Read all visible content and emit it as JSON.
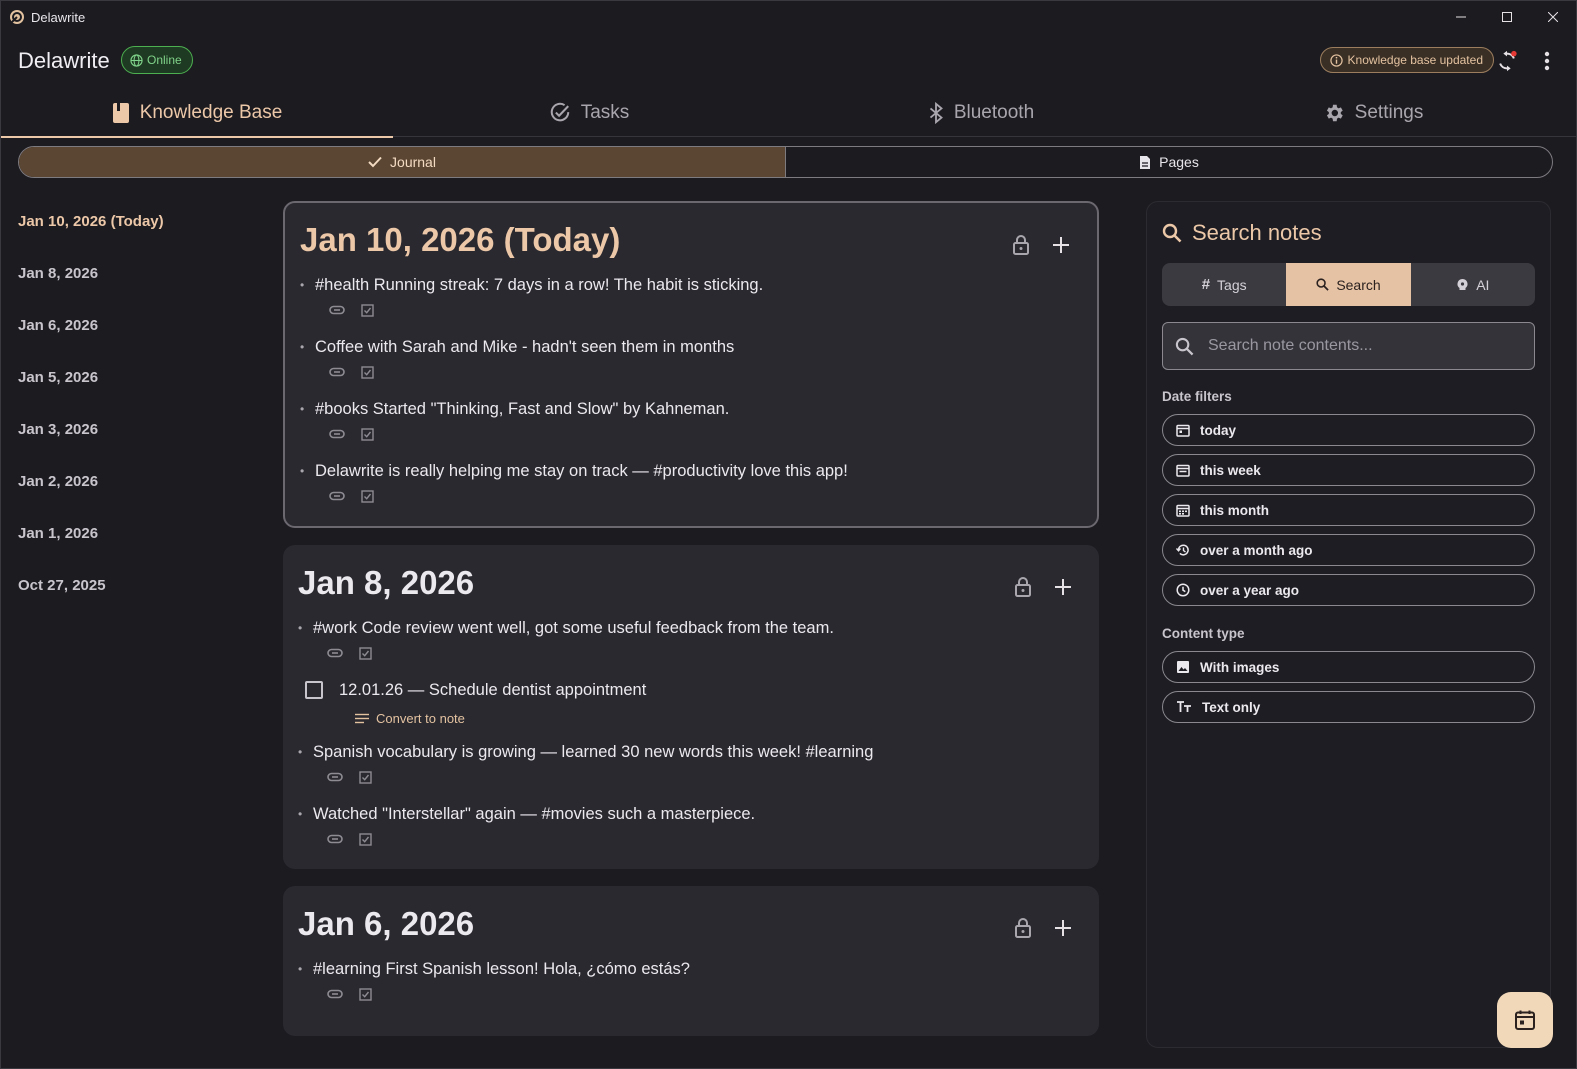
{
  "window": {
    "title": "Delawrite"
  },
  "header": {
    "app_title": "Delawrite",
    "online_label": "Online",
    "kb_status_label": "Knowledge base updated"
  },
  "main_tabs": [
    {
      "label": "Knowledge Base",
      "icon": "book-icon",
      "active": true
    },
    {
      "label": "Tasks",
      "icon": "check-circle-icon",
      "active": false
    },
    {
      "label": "Bluetooth",
      "icon": "bluetooth-icon",
      "active": false
    },
    {
      "label": "Settings",
      "icon": "gear-icon",
      "active": false
    }
  ],
  "view_toggle": {
    "journal": "Journal",
    "pages": "Pages",
    "selected": "Journal"
  },
  "dates": [
    "Jan 10, 2026 (Today)",
    "Jan 8, 2026",
    "Jan 6, 2026",
    "Jan 5, 2026",
    "Jan 3, 2026",
    "Jan 2, 2026",
    "Jan 1, 2026",
    "Oct 27, 2025"
  ],
  "cards": [
    {
      "title": "Jan 10, 2026 (Today)",
      "notes": [
        "#health Running streak: 7 days in a row! The habit is sticking.",
        "Coffee with Sarah and Mike - hadn't seen them in months",
        "#books Started \"Thinking, Fast and Slow\" by Kahneman.",
        "Delawrite is really helping me stay on track — #productivity love this app!"
      ]
    },
    {
      "title": "Jan 8, 2026",
      "note_first": "#work Code review went well, got some useful feedback from the team.",
      "task": {
        "text": "12.01.26 — Schedule dentist appointment",
        "checked": false,
        "convert_label": "Convert to note"
      },
      "notes_after": [
        "Spanish vocabulary is growing — learned 30 new words this week! #learning",
        "Watched \"Interstellar\" again — #movies such a masterpiece."
      ]
    },
    {
      "title": "Jan 6, 2026",
      "notes": [
        "#learning First Spanish lesson! Hola, ¿cómo estás?"
      ]
    }
  ],
  "search_panel": {
    "title": "Search notes",
    "tabs": [
      {
        "label": "Tags",
        "icon": "hash-icon"
      },
      {
        "label": "Search",
        "icon": "search-icon"
      },
      {
        "label": "AI",
        "icon": "ai-bulb-icon"
      }
    ],
    "active_tab": "Search",
    "input_placeholder": "Search note contents...",
    "date_filters_label": "Date filters",
    "date_filters": [
      "today",
      "this week",
      "this month",
      "over a month ago",
      "over a year ago"
    ],
    "content_type_label": "Content type",
    "content_types": [
      "With images",
      "Text only"
    ]
  },
  "colors": {
    "accent": "#ecc8a8",
    "background": "#1c1b20",
    "card": "#2a2930",
    "online": "#7fd38a"
  }
}
